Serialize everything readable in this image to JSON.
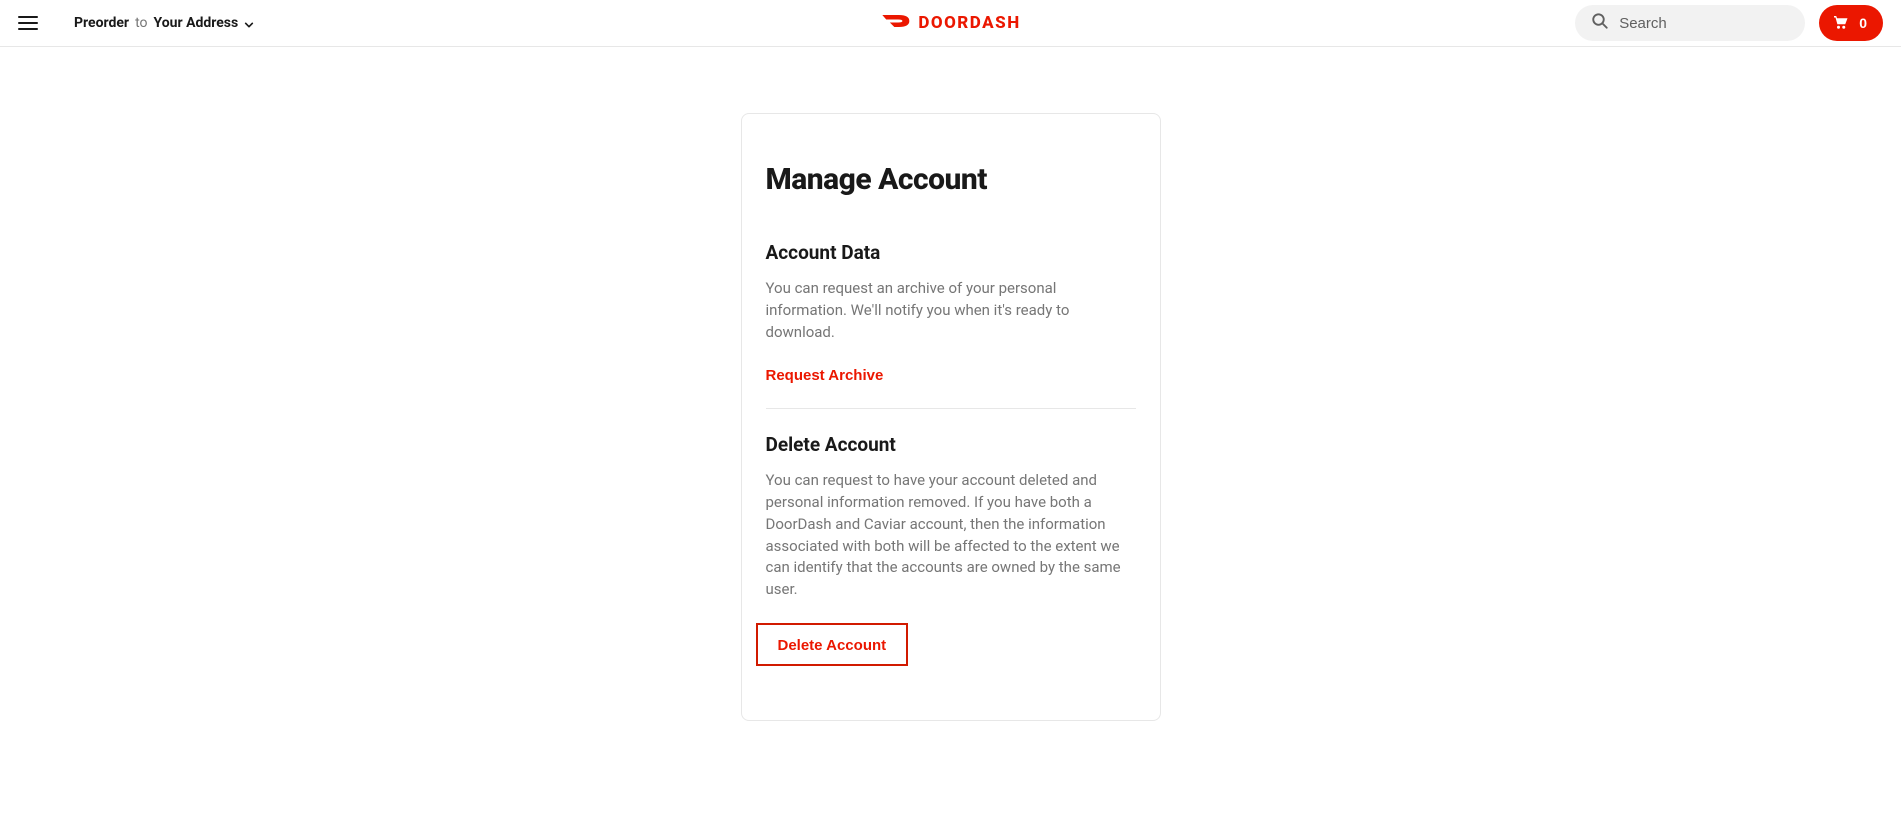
{
  "header": {
    "preorder_label": "Preorder",
    "to_label": "to",
    "address_label": "Your Address",
    "logo_text": "DOORDASH",
    "search_placeholder": "Search",
    "cart_count": "0"
  },
  "page": {
    "title": "Manage Account",
    "sections": [
      {
        "heading": "Account Data",
        "body": "You can request an archive of your personal information. We'll notify you when it's ready to download.",
        "action": "Request Archive"
      },
      {
        "heading": "Delete Account",
        "body": "You can request to have your account deleted and personal information removed. If you have both a DoorDash and Caviar account, then the information associated with both will be affected to the extent we can identify that the accounts are owned by the same user.",
        "action": "Delete Account"
      }
    ]
  }
}
